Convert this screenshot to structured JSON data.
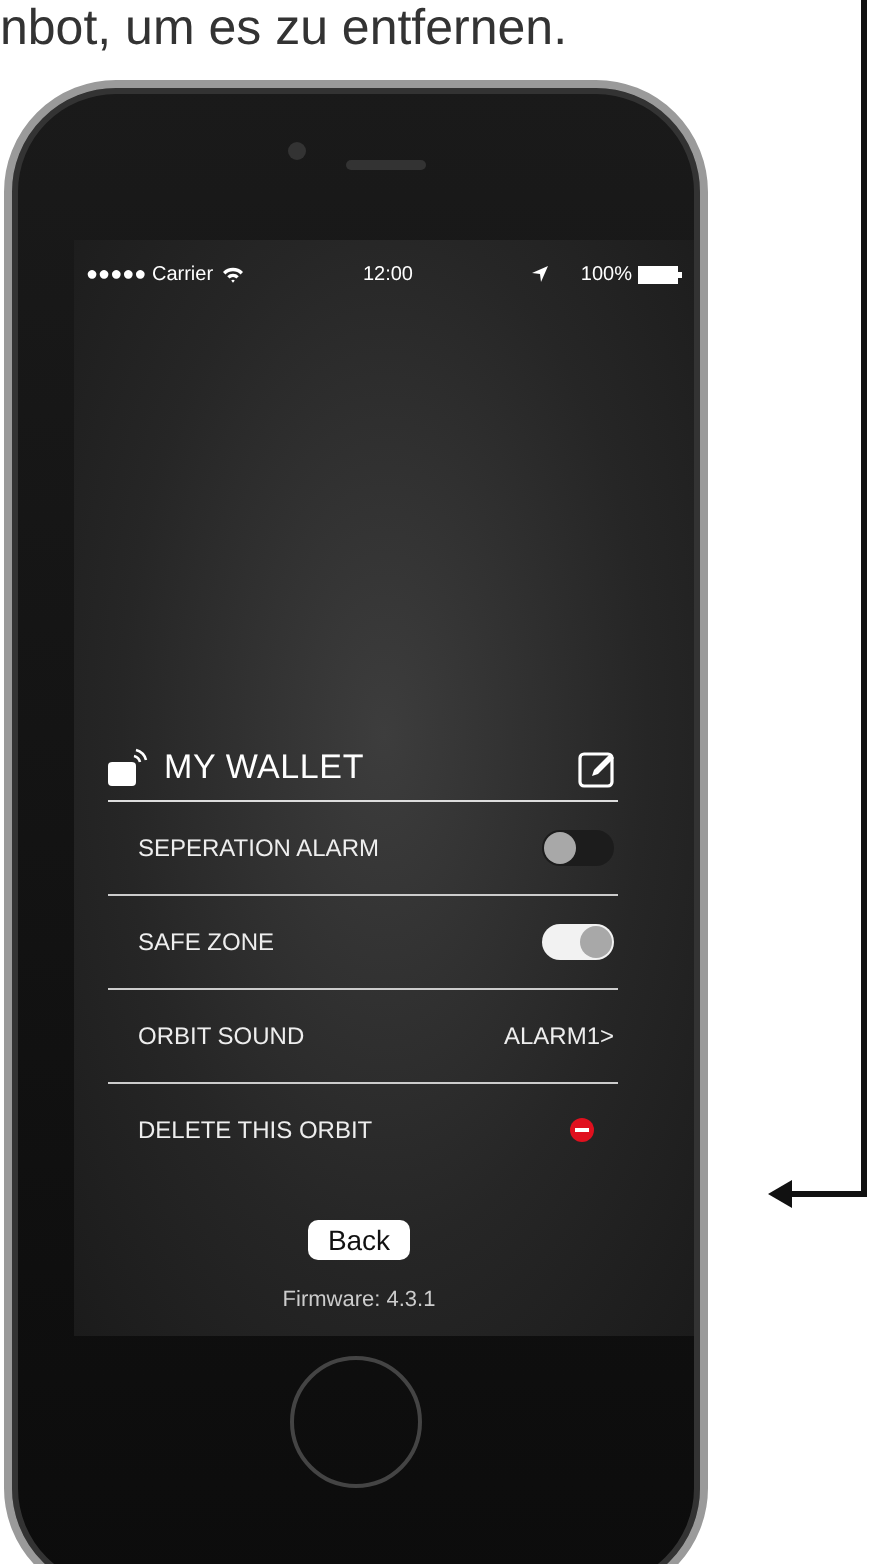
{
  "caption": "nbot, um es zu entfernen.",
  "status_bar": {
    "carrier": "●●●●● Carrier",
    "time": "12:00",
    "battery": "100%"
  },
  "device": {
    "name": "MY WALLET"
  },
  "settings": [
    {
      "kind": "toggle",
      "label": "SEPERATION ALARM",
      "on": false
    },
    {
      "kind": "toggle",
      "label": "SAFE ZONE",
      "on": true
    },
    {
      "kind": "value",
      "label": "ORBIT SOUND",
      "value": "ALARM1>"
    },
    {
      "kind": "delete",
      "label": "DELETE THIS ORBIT"
    }
  ],
  "back_button": "Back",
  "firmware": "Firmware: 4.3.1"
}
